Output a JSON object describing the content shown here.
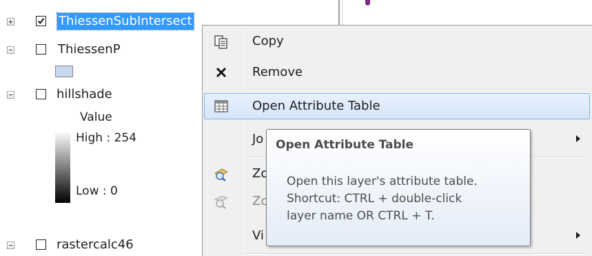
{
  "toc": {
    "layers": [
      {
        "name": "ThiessenSubIntersect",
        "checked": true,
        "expanded": false,
        "selected": true
      },
      {
        "name": "ThiessenP",
        "checked": false,
        "expanded": true,
        "selected": false
      },
      {
        "name": "hillshade",
        "checked": false,
        "expanded": true,
        "selected": false
      },
      {
        "name": "rastercalc46",
        "checked": false,
        "expanded": true,
        "selected": false
      }
    ],
    "hillshade_legend": {
      "field": "Value",
      "high": "High : 254",
      "low": "Low : 0"
    }
  },
  "context_menu": {
    "items": [
      {
        "label": "Copy",
        "icon": "copy-icon",
        "enabled": true,
        "submenu": false
      },
      {
        "label": "Remove",
        "icon": "remove-x-icon",
        "enabled": true,
        "submenu": false
      },
      {
        "label": "Open Attribute Table",
        "icon": "table-icon",
        "enabled": true,
        "submenu": false,
        "hovered": true
      },
      {
        "label": "Jo",
        "icon": "",
        "enabled": true,
        "submenu": true
      },
      {
        "label": "Zo",
        "icon": "zoom-to-layer-icon",
        "enabled": true,
        "submenu": false
      },
      {
        "label": "Zo",
        "icon": "zoom-to-scale-icon",
        "enabled": false,
        "submenu": false
      },
      {
        "label": "Vi",
        "icon": "",
        "enabled": true,
        "submenu": true
      }
    ]
  },
  "tooltip": {
    "title": "Open Attribute Table",
    "lines": [
      "Open this layer's attribute table.",
      "Shortcut: CTRL + double-click",
      "layer name OR CTRL + T."
    ]
  },
  "colors": {
    "selection": "#3399ff",
    "menu_hover_border": "#7eb4ea",
    "menu_background": "#f0f0f0",
    "polygon_fill": "#c9d8f0"
  }
}
